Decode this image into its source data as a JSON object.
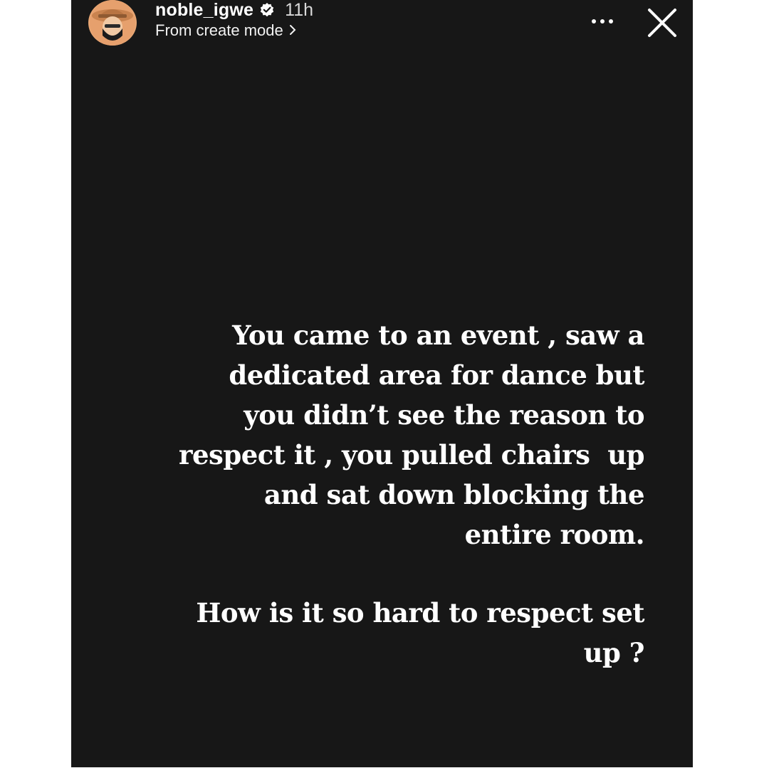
{
  "story": {
    "background": "#171717",
    "header": {
      "username": "noble_igwe",
      "time": "11h",
      "subtitle": "From create mode",
      "icons": {
        "verified": "verified-badge-icon",
        "chevron": "chevron-right-icon",
        "more": "more-options-icon",
        "close": "close-icon"
      }
    },
    "text": {
      "paragraph1": [
        "You came to an event , saw a",
        "dedicated area for dance but",
        "you didn’t see the reason to",
        "respect it , you pulled chairs  up",
        "and sat down blocking the",
        "entire room."
      ],
      "paragraph2": [
        "How is it so hard to respect set",
        "up ?"
      ]
    }
  }
}
